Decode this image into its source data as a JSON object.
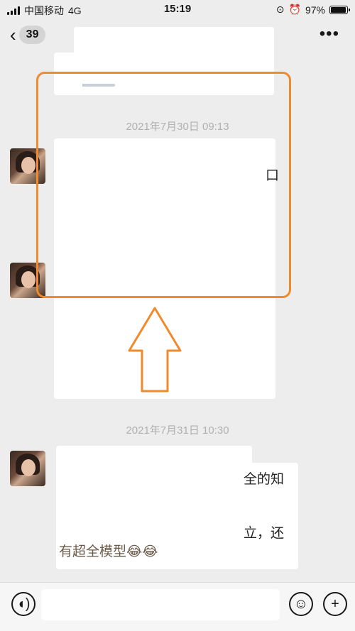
{
  "status_bar": {
    "carrier": "中国移动",
    "network": "4G",
    "time": "15:19",
    "battery": "97%",
    "battery_level": 0.97,
    "alarm_icon": "alarm-icon",
    "lock_icon": "rotation-lock-icon"
  },
  "nav": {
    "back_icon": "chevron-left-icon",
    "unread_count": "39",
    "more_icon": "more-dots-icon"
  },
  "messages": [
    {
      "type": "timestamp",
      "text": "2021年7月30日 09:13"
    },
    {
      "type": "fragment",
      "text": "口"
    },
    {
      "type": "timestamp",
      "text": "2021年7月31日 10:30"
    },
    {
      "type": "fragment",
      "text": "全的知"
    },
    {
      "type": "fragment",
      "text": "立，还"
    },
    {
      "type": "fragment",
      "text": "有超全模型😂😂"
    }
  ],
  "annotation": {
    "box_color": "#f08a2b",
    "arrow_color": "#f08a2b",
    "arrow_icon": "up-arrow-icon"
  },
  "input_bar": {
    "voice_icon": "voice-icon",
    "emoji_icon": "emoji-icon",
    "plus_icon": "plus-icon"
  },
  "colors": {
    "background": "#ededed",
    "bubble": "#ffffff",
    "timestamp": "#b0b0b0"
  }
}
